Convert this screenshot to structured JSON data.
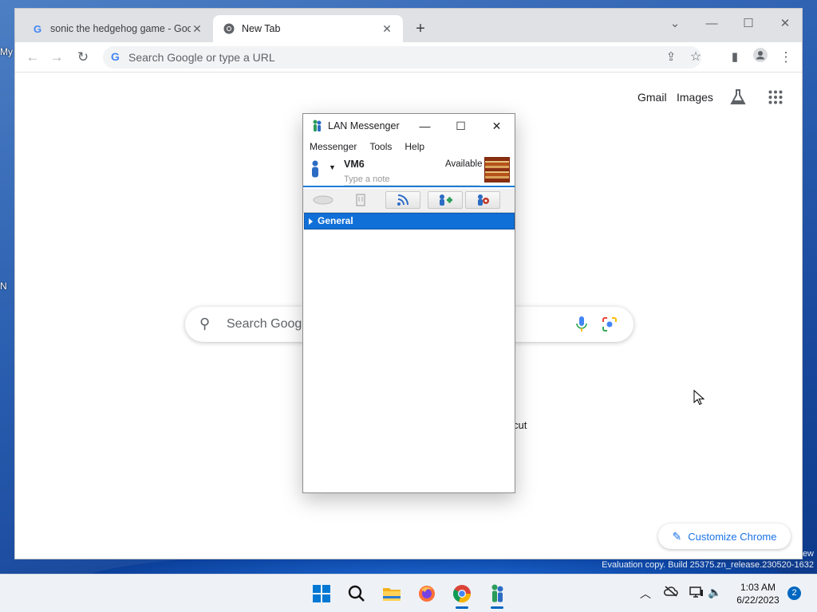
{
  "desktop": {
    "labels": [
      "My",
      "N"
    ],
    "watermark_line1": "ew",
    "watermark_line2": "Evaluation copy. Build 25375.zn_release.230520-1632"
  },
  "browser": {
    "tabs": [
      {
        "title": "sonic the hedgehog game - Goo",
        "favicon": "google-g-icon",
        "active": false
      },
      {
        "title": "New Tab",
        "favicon": "chrome-icon",
        "active": true
      }
    ],
    "omnibox": {
      "placeholder": "Search Google or type a URL",
      "value": ""
    },
    "ntp": {
      "gmail": "Gmail",
      "images": "Images",
      "search_placeholder": "Search Googl",
      "shortcut_fragment": "cut",
      "customize_label": "Customize Chrome"
    }
  },
  "lan_messenger": {
    "title": "LAN Messenger",
    "menu": [
      "Messenger",
      "Tools",
      "Help"
    ],
    "user": {
      "name": "VM6",
      "status": "Available",
      "note_placeholder": "Type a note"
    },
    "group": "General"
  },
  "taskbar": {
    "time": "1:03 AM",
    "date": "6/22/2023",
    "notifications": "2"
  },
  "colors": {
    "accent": "#1a73e8",
    "selection": "#1170d8",
    "taskbar_accent": "#0067c0"
  }
}
